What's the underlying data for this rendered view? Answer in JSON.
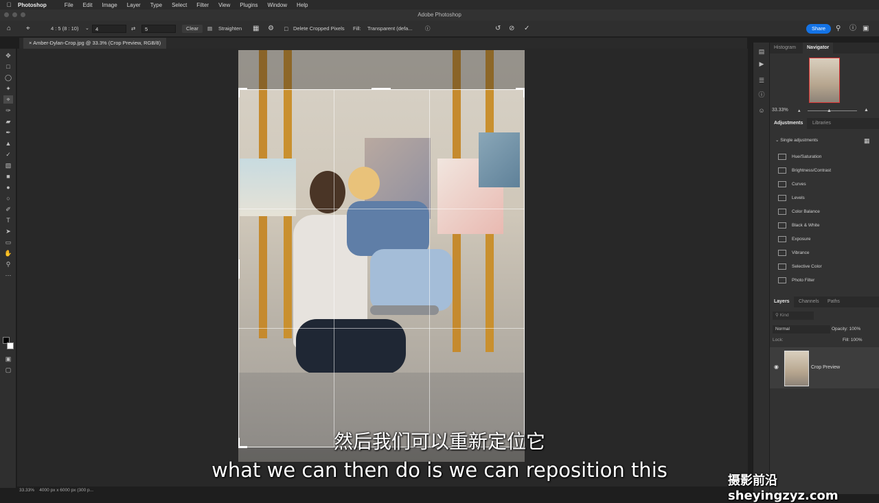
{
  "menubar": {
    "app_name": "Photoshop",
    "items": [
      "File",
      "Edit",
      "Image",
      "Layer",
      "Type",
      "Select",
      "Filter",
      "View",
      "Plugins",
      "Window",
      "Help"
    ]
  },
  "window": {
    "title": "Adobe Photoshop"
  },
  "options": {
    "ratio_preset": "4 : 5 (8 : 10)",
    "width_value": "4",
    "height_value": "5",
    "clear_label": "Clear",
    "straighten_label": "Straighten",
    "delete_cropped_label": "Delete Cropped Pixels",
    "fill_label": "Fill:",
    "fill_value": "Transparent (defa...",
    "share_label": "Share"
  },
  "document": {
    "tab_title": "Amber-Dylan-Crop.jpg @ 33.3% (Crop Preview, RGB/8)",
    "status_zoom": "33.33%",
    "status_info": "4000 px x 6000 px (300 p..."
  },
  "navigator_panel": {
    "tabs": [
      "Histogram",
      "Navigator"
    ],
    "active_tab": "Navigator",
    "zoom": "33.33%"
  },
  "adjustments_panel": {
    "tabs": [
      "Adjustments",
      "Libraries"
    ],
    "active_tab": "Adjustments",
    "section_label": "Single adjustments",
    "items": [
      "Hue/Saturation",
      "Brightness/Contrast",
      "Curves",
      "Levels",
      "Color Balance",
      "Black & White",
      "Exposure",
      "Vibrance",
      "Selective Color",
      "Photo Filter"
    ]
  },
  "layers_panel": {
    "tabs": [
      "Layers",
      "Channels",
      "Paths"
    ],
    "active_tab": "Layers",
    "kind_placeholder": "Kind",
    "blend_mode": "Normal",
    "opacity_label": "Opacity:",
    "opacity_value": "100%",
    "lock_label": "Lock:",
    "fill_label": "Fill:",
    "fill_value": "100%",
    "layers": [
      {
        "name": "Crop Preview"
      }
    ]
  },
  "subtitles": {
    "chinese": "然后我们可以重新定位它",
    "english": "what we can then do is we can reposition this"
  },
  "watermark": "摄影前沿 sheyingzyz.com",
  "colors": {
    "accent": "#1473e6",
    "panel_bg": "#323232",
    "canvas_bg": "#282828"
  }
}
